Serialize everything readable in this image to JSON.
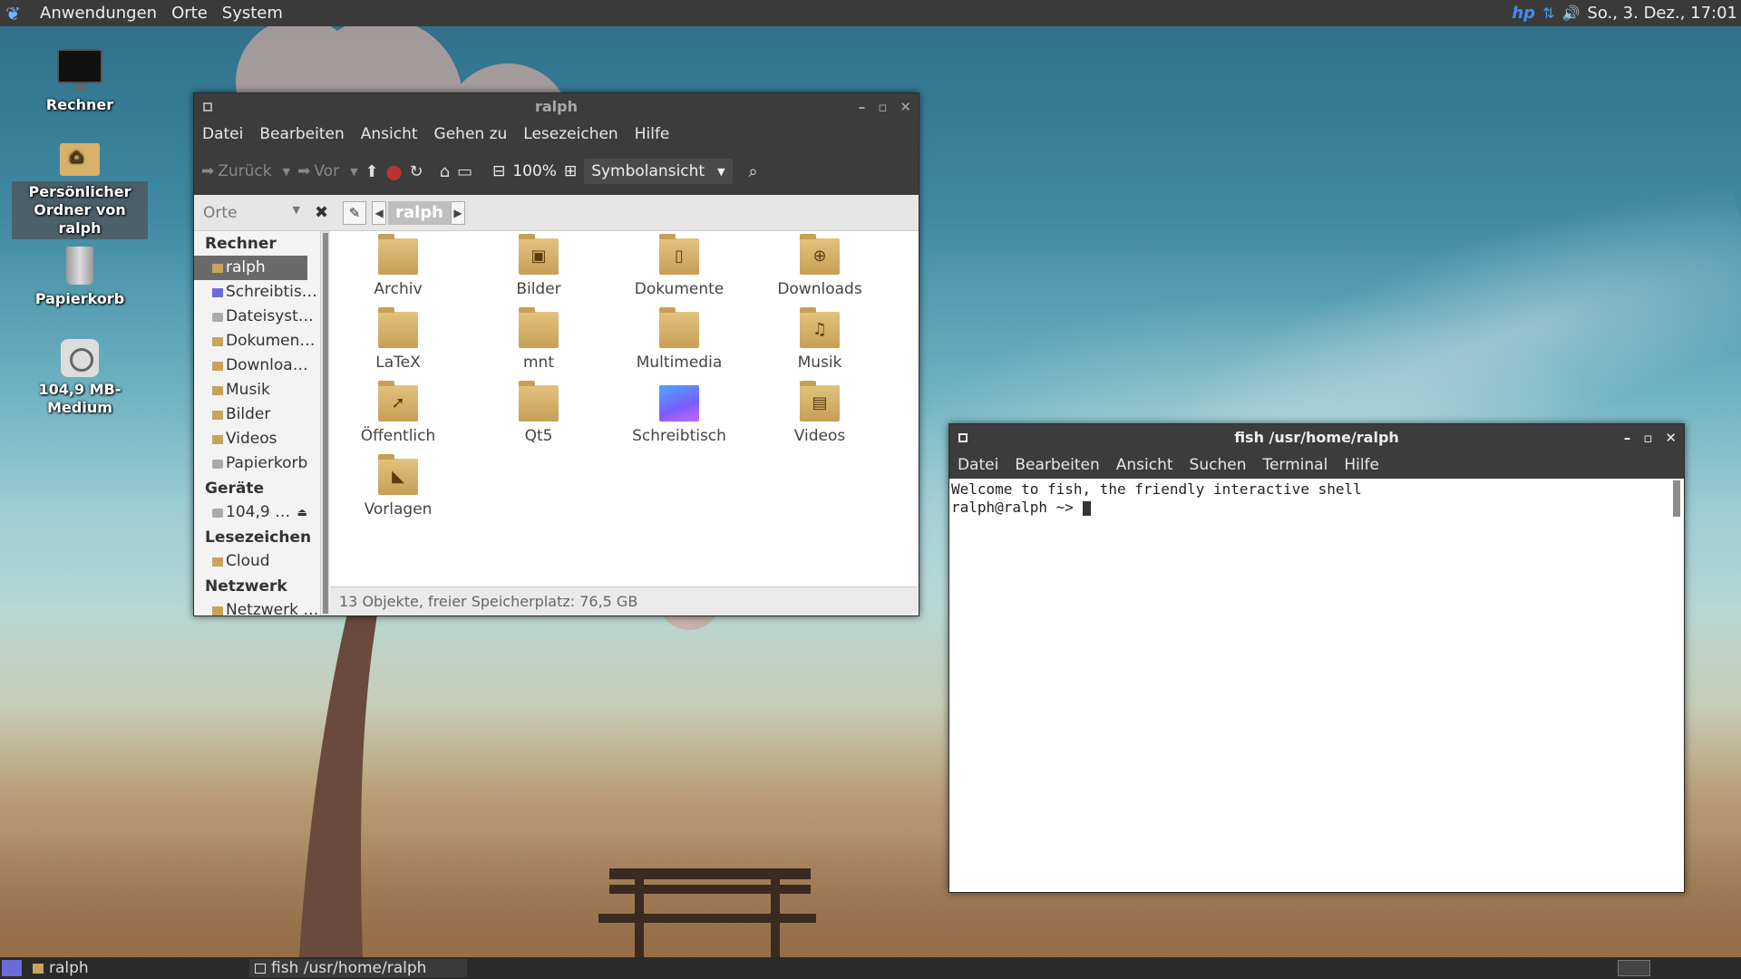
{
  "top_panel": {
    "menus": [
      "Anwendungen",
      "Orte",
      "System"
    ],
    "clock": "So., 3. Dez., 17:01",
    "tray_hp": "hp"
  },
  "desktop_icons": [
    {
      "label": "Rechner"
    },
    {
      "label": "Persönlicher Ordner von ralph"
    },
    {
      "label": "Papierkorb"
    },
    {
      "label": "104,9 MB-Medium"
    }
  ],
  "file_manager": {
    "title": "ralph",
    "menus": [
      "Datei",
      "Bearbeiten",
      "Ansicht",
      "Gehen zu",
      "Lesezeichen",
      "Hilfe"
    ],
    "toolbar": {
      "back": "Zurück",
      "forward": "Vor",
      "zoom": "100%",
      "view": "Symbolansicht"
    },
    "places_label": "Orte",
    "breadcrumb": "ralph",
    "sidebar": {
      "sections": [
        {
          "title": "Rechner",
          "items": [
            "ralph",
            "Schreibtis…",
            "Dateisyst…",
            "Dokumen…",
            "Downloa…",
            "Musik",
            "Bilder",
            "Videos",
            "Papierkorb"
          ]
        },
        {
          "title": "Geräte",
          "items": [
            "104,9 …"
          ]
        },
        {
          "title": "Lesezeichen",
          "items": [
            "Cloud"
          ]
        },
        {
          "title": "Netzwerk",
          "items": [
            "Netzwerk …"
          ]
        }
      ]
    },
    "files": [
      {
        "name": "Archiv",
        "glyph": ""
      },
      {
        "name": "Bilder",
        "glyph": "▣"
      },
      {
        "name": "Dokumente",
        "glyph": "▯"
      },
      {
        "name": "Downloads",
        "glyph": "⊕"
      },
      {
        "name": "LaTeX",
        "glyph": ""
      },
      {
        "name": "mnt",
        "glyph": ""
      },
      {
        "name": "Multimedia",
        "glyph": ""
      },
      {
        "name": "Musik",
        "glyph": "♫"
      },
      {
        "name": "Öffentlich",
        "glyph": "➚"
      },
      {
        "name": "Qt5",
        "glyph": ""
      },
      {
        "name": "Schreibtisch",
        "glyph": ""
      },
      {
        "name": "Videos",
        "glyph": "▤"
      },
      {
        "name": "Vorlagen",
        "glyph": "◣"
      }
    ],
    "status": "13 Objekte, freier Speicherplatz: 76,5 GB"
  },
  "terminal": {
    "title": "fish  /usr/home/ralph",
    "menus": [
      "Datei",
      "Bearbeiten",
      "Ansicht",
      "Suchen",
      "Terminal",
      "Hilfe"
    ],
    "lines": [
      "Welcome to fish, the friendly interactive shell"
    ],
    "prompt": "ralph@ralph ~> "
  },
  "taskbar": {
    "tasks": [
      "ralph",
      "fish  /usr/home/ralph"
    ]
  }
}
